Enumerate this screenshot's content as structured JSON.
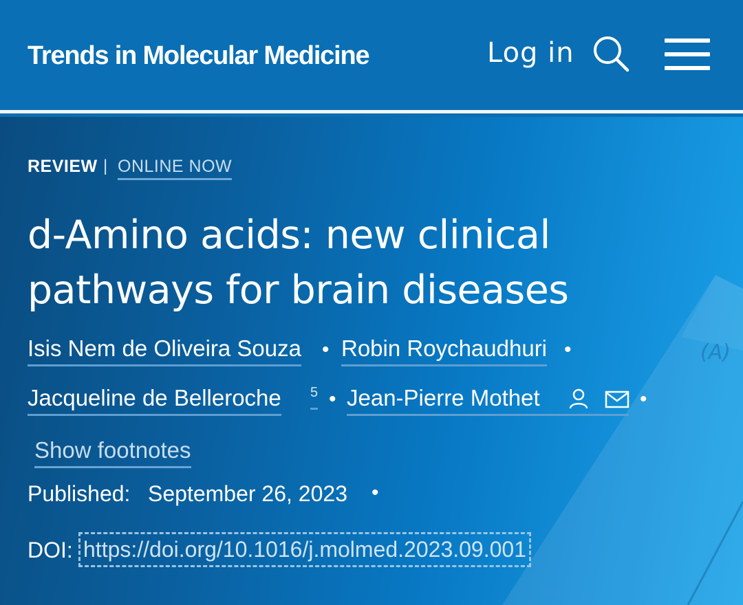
{
  "header": {
    "journal_title": "Trends in Molecular Medicine",
    "login_label": "Log in",
    "search_icon": "search-icon",
    "menu_icon": "hamburger-menu-icon"
  },
  "article": {
    "type": "REVIEW",
    "separator": "|",
    "status": "ONLINE NOW",
    "title": "d-Amino acids: new clinical pathways for brain diseases",
    "authors": [
      {
        "name": "Isis Nem de Oliveira Souza"
      },
      {
        "name": "Robin Roychaudhuri"
      },
      {
        "name": "Jacqueline de Belleroche",
        "footnote": "5"
      },
      {
        "name": "Jean-Pierre Mothet"
      }
    ],
    "author_separator": "•",
    "show_footnotes_label": "Show footnotes",
    "published_label": "Published:",
    "published_date": "September 26, 2023",
    "doi_label": "DOI:",
    "doi_url": "https://doi.org/10.1016/j.molmed.2023.09.001"
  },
  "colors": {
    "header_bg": "#0a6fb4",
    "hero_dark": "#0a4c80",
    "hero_light": "#1aa3e8",
    "link_underline": "#5f9fd1"
  }
}
